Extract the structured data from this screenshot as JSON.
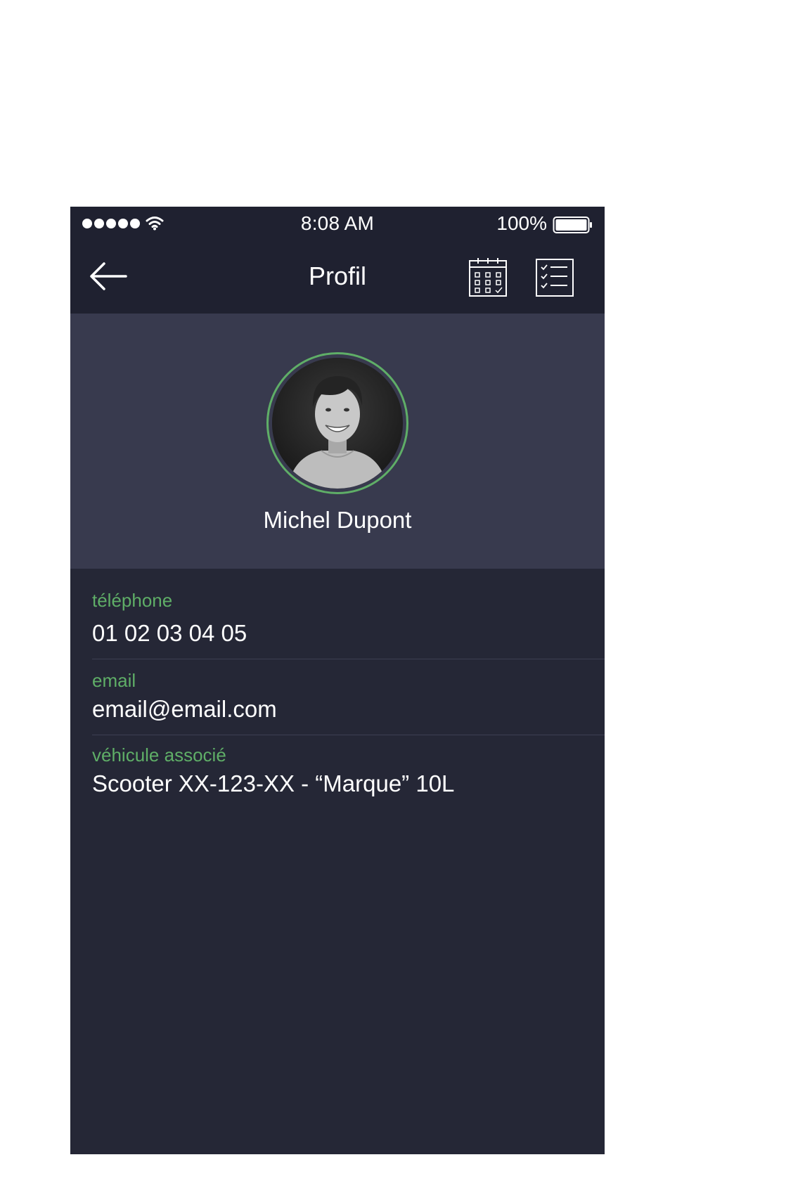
{
  "status_bar": {
    "signal_icon": "signal-dots-icon",
    "wifi_icon": "wifi-icon",
    "time": "8:08 AM",
    "battery_percent": "100%",
    "battery_icon": "battery-icon"
  },
  "nav": {
    "back_icon": "arrow-left-icon",
    "title": "Profil",
    "calendar_icon": "calendar-icon",
    "checklist_icon": "checklist-icon"
  },
  "profile": {
    "name": "Michel Dupont",
    "avatar_icon": "avatar-photo"
  },
  "fields": [
    {
      "label": "téléphone",
      "value": "01 02 03 04 05"
    },
    {
      "label": "email",
      "value": "email@email.com"
    },
    {
      "label": "véhicule associé",
      "value": "Scooter XX-123-XX - “Marque” 10L"
    }
  ],
  "colors": {
    "bar_bg": "#1f2130",
    "hero_bg": "#383a4e",
    "body_bg": "#252736",
    "accent": "#5fae67",
    "text": "#ffffff"
  }
}
